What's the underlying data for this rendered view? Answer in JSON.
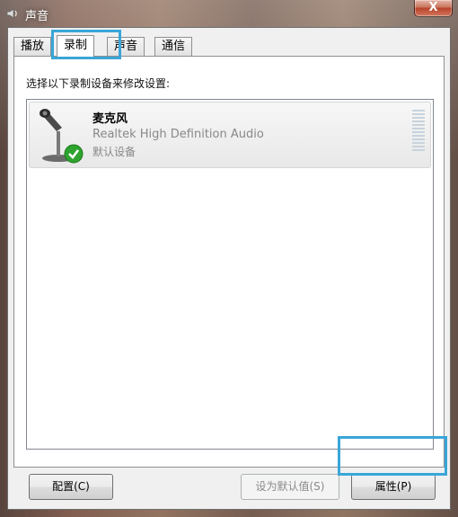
{
  "window": {
    "title": "声音",
    "close_label": "X"
  },
  "tabs": [
    {
      "label": "播放",
      "active": false
    },
    {
      "label": "录制",
      "active": true
    },
    {
      "label": "声音",
      "active": false
    },
    {
      "label": "通信",
      "active": false
    }
  ],
  "recording": {
    "instruction": "选择以下录制设备来修改设置:",
    "devices": [
      {
        "name": "麦克风",
        "driver": "Realtek High Definition Audio",
        "status": "默认设备",
        "icon": "microphone-icon",
        "badge": "default-check-icon"
      }
    ]
  },
  "buttons": {
    "configure": "配置(C)",
    "set_default": "设为默认值(S)",
    "properties": "属性(P)"
  },
  "colors": {
    "highlight": "#3aa6d8",
    "check": "#2ea32e"
  }
}
